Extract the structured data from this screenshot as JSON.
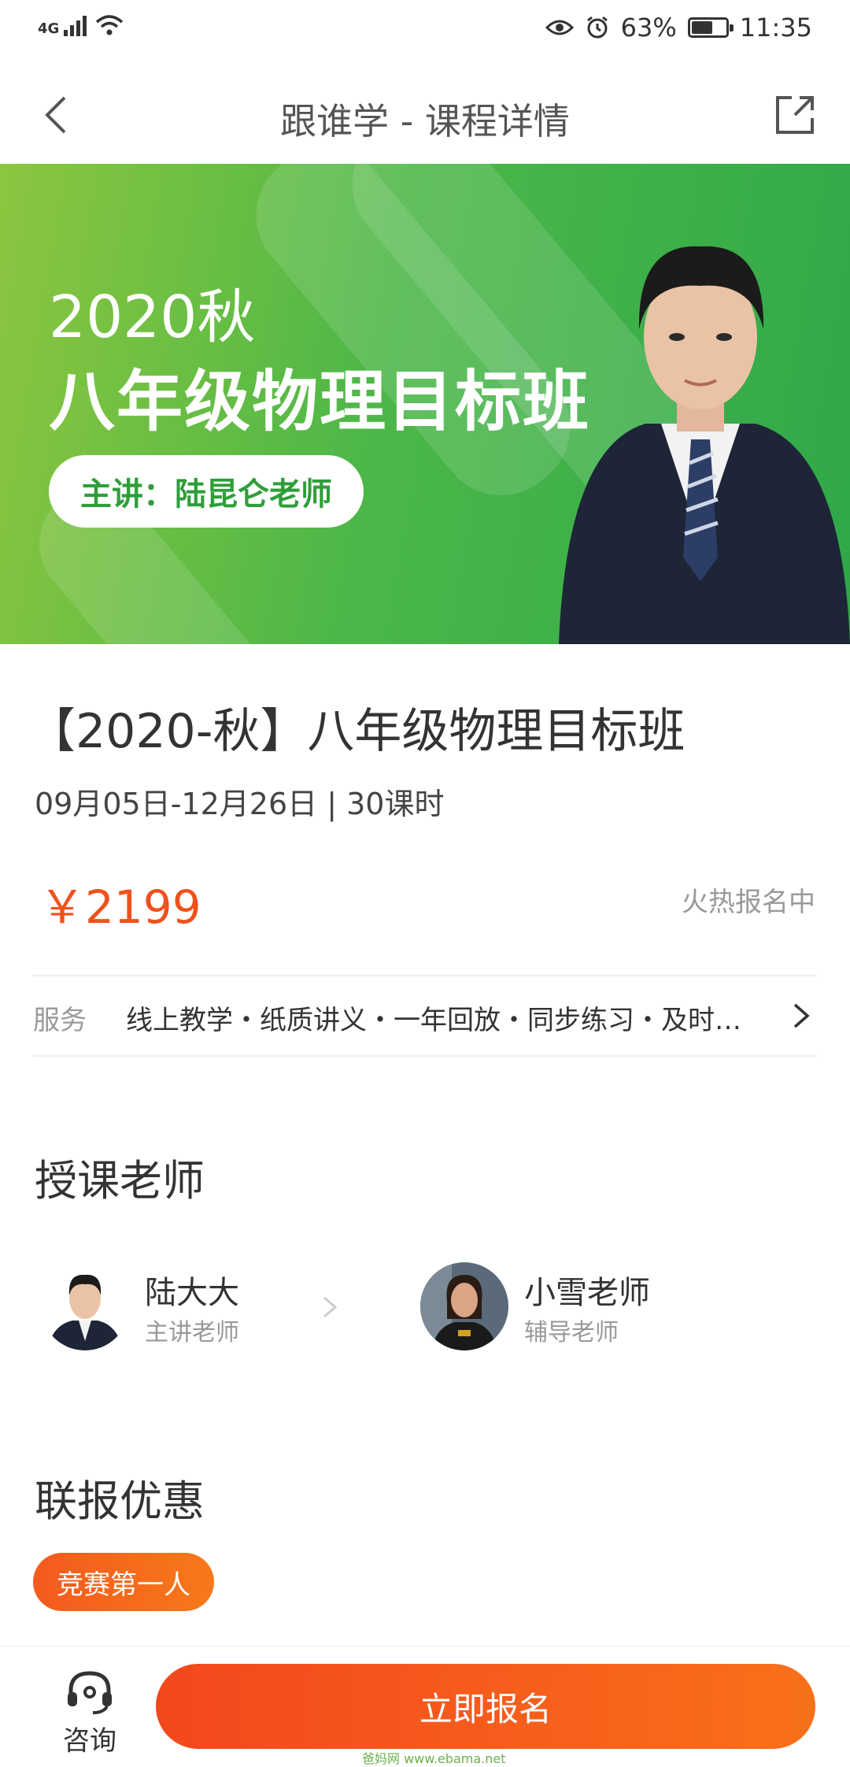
{
  "status_bar": {
    "network": "4G",
    "battery": "63%",
    "battery_level": 0.63,
    "time": "11:35"
  },
  "nav": {
    "title": "跟谁学 - 课程详情",
    "back_icon": "chevron-left-icon",
    "share_icon": "share-icon"
  },
  "banner": {
    "year": "2020秋",
    "title": "八年级物理目标班",
    "lecturer": "主讲：陆昆仑老师",
    "colors": {
      "from": "#8cc63f",
      "to": "#2fa84a"
    }
  },
  "course": {
    "title": "【2020-秋】八年级物理目标班",
    "meta": "09月05日-12月26日 | 30课时",
    "price": "￥2199",
    "status": "火热报名中"
  },
  "service": {
    "label": "服务",
    "items": "线上教学・纸质讲义・一年回放・同步练习・及时…"
  },
  "teachers": {
    "section_title": "授课老师",
    "list": [
      {
        "name": "陆大大",
        "role": "主讲老师"
      },
      {
        "name": "小雪老师",
        "role": "辅导老师"
      }
    ]
  },
  "promo": {
    "section_title": "联报优惠",
    "tag": "竞赛第一人"
  },
  "bottom": {
    "consult_label": "咨询",
    "enroll_label": "立即报名",
    "accent": "#f4471d"
  },
  "watermark": "爸妈网 www.ebama.net"
}
